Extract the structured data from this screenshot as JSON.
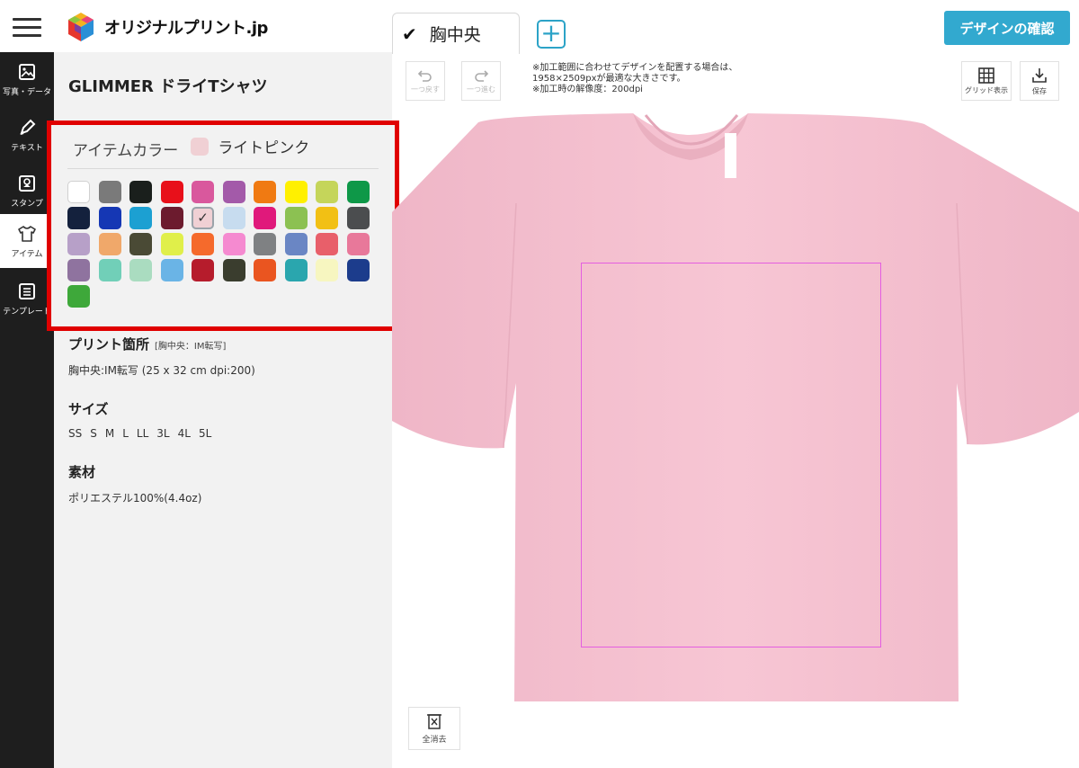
{
  "header": {
    "logo_text": "オリジナルプリント.jp",
    "tab_label": "胸中央",
    "add_tab": "+",
    "confirm_label": "デザインの確認"
  },
  "rail": [
    {
      "label": "写真・データ",
      "icon": "image-icon"
    },
    {
      "label": "テキスト",
      "icon": "pen-icon"
    },
    {
      "label": "スタンプ",
      "icon": "stamp-icon"
    },
    {
      "label": "アイテム",
      "icon": "tshirt-icon"
    },
    {
      "label": "テンプレート",
      "icon": "template-icon"
    }
  ],
  "panel": {
    "product_title": "GLIMMER ドライTシャツ",
    "color": {
      "heading": "アイテムカラー",
      "selected_name": "ライトピンク",
      "selected_color": "#f0d0d4",
      "swatches": [
        "#ffffff",
        "#7a7a7a",
        "#1a1f1c",
        "#e8101a",
        "#d9589d",
        "#a35aa9",
        "#f07a12",
        "#fff000",
        "#c5d55a",
        "#0e9848",
        "#14213d",
        "#1537b4",
        "#1ca0d2",
        "#6c1b2e",
        "#f0d0d4",
        "#c7dcef",
        "#e0197b",
        "#8cc152",
        "#f2c014",
        "#4b4d4f",
        "#b7a0c8",
        "#f0a86a",
        "#4a4a35",
        "#e0ef4a",
        "#f56a2c",
        "#f58ad0",
        "#7f8183",
        "#6a86c4",
        "#e85f6a",
        "#e8789a",
        "#8f739f",
        "#71cfb8",
        "#aadcc0",
        "#6ab4e6",
        "#b61c2c",
        "#3a3d2e",
        "#ea5520",
        "#2aa6ae",
        "#f7f6c0",
        "#1c3c8c",
        "#3ea83a"
      ],
      "selected_index": 14
    },
    "print": {
      "heading": "プリント箇所",
      "sub": "[胸中央：IM転写]",
      "detail": "胸中央:IM転写 (25 x 32 cm dpi:200)"
    },
    "size": {
      "heading": "サイズ",
      "options": [
        "SS",
        "S",
        "M",
        "L",
        "LL",
        "3L",
        "4L",
        "5L"
      ]
    },
    "material": {
      "heading": "素材",
      "detail": "ポリエステル100%(4.4oz)"
    }
  },
  "canvas": {
    "undo_label": "一つ戻す",
    "redo_label": "一つ進む",
    "note_line1": "※加工範囲に合わせてデザインを配置する場合は、",
    "note_line2": "1958×2509pxが最適な大きさです。",
    "note_line3": "※加工時の解像度：200dpi",
    "grid_label": "グリッド表示",
    "save_label": "保存",
    "clear_label": "全消去",
    "shirt_color": "#f7c6d4",
    "print_area_color": "#e45ee0",
    "accent": "#32a9cf"
  }
}
